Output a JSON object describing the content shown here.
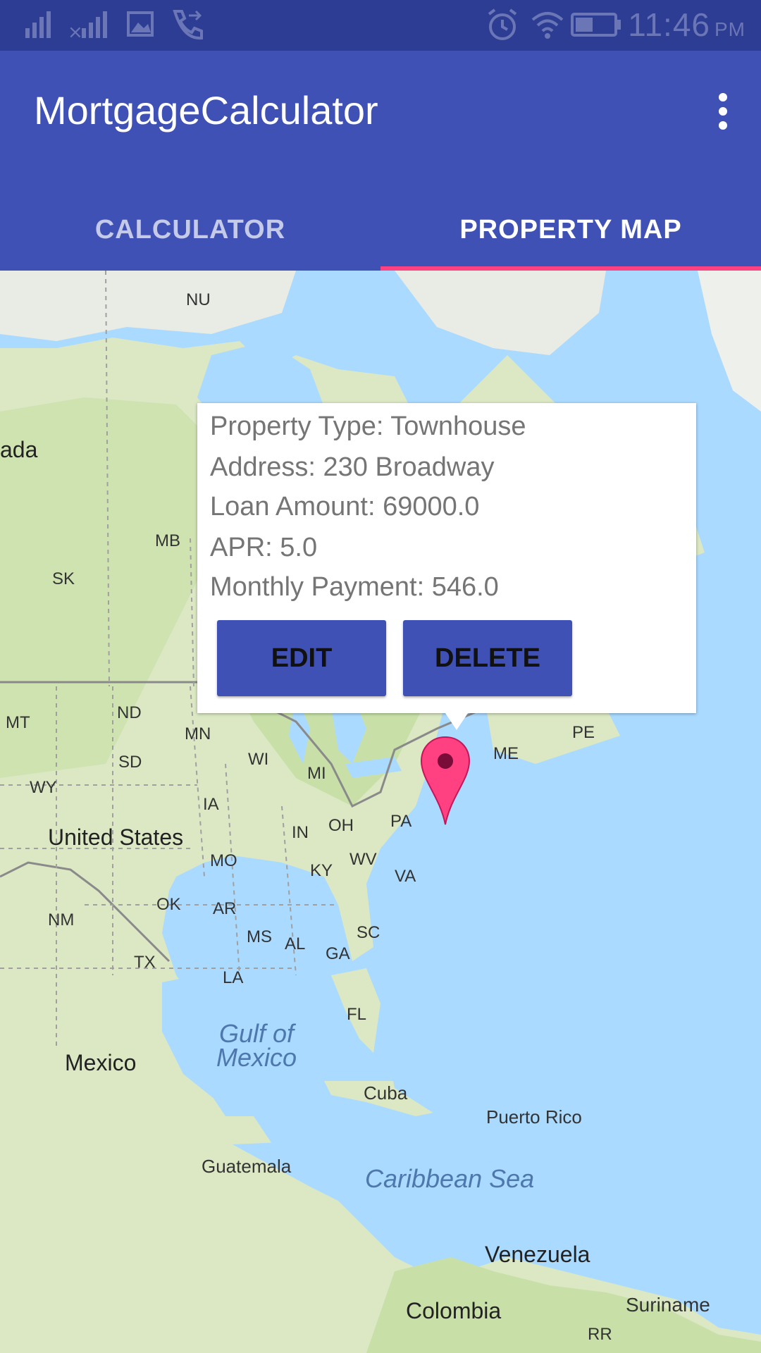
{
  "status_bar": {
    "time": "11:46",
    "ampm": "PM",
    "icons": [
      "signal-1-icon",
      "signal-2-icon",
      "gallery-icon",
      "call-forward-icon",
      "alarm-icon",
      "wifi-icon",
      "battery-icon"
    ]
  },
  "app_bar": {
    "title": "MortgageCalculator",
    "overflow_icon": "more-vert-icon",
    "tabs": [
      {
        "label": "CALCULATOR",
        "selected": false
      },
      {
        "label": "PROPERTY MAP",
        "selected": true
      }
    ]
  },
  "map": {
    "labels": {
      "nu": "NU",
      "ada": "ada",
      "mb": "MB",
      "sk": "SK",
      "mt": "MT",
      "nd": "ND",
      "mn": "MN",
      "sd": "SD",
      "wy": "WY",
      "wi": "WI",
      "mi": "MI",
      "ia": "IA",
      "me": "ME",
      "pe": "PE",
      "pa": "PA",
      "oh": "OH",
      "in": "IN",
      "united_states": "United States",
      "mo": "MO",
      "ky": "KY",
      "wv": "WV",
      "va": "VA",
      "ok": "OK",
      "ar": "AR",
      "nm": "NM",
      "ms": "MS",
      "al": "AL",
      "ga": "GA",
      "sc": "SC",
      "tx": "TX",
      "la": "LA",
      "fl": "FL",
      "gulf": "Gulf of Mexico",
      "mexico": "Mexico",
      "cuba": "Cuba",
      "puerto_rico": "Puerto Rico",
      "guatemala": "Guatemala",
      "caribbean": "Caribbean Sea",
      "venezuela": "Venezuela",
      "colombia": "Colombia",
      "suriname": "Suriname",
      "rr": "RR"
    },
    "marker_icon": "map-pin-icon",
    "colors": {
      "water": "#aadaff",
      "land": "#dce9c4",
      "accent": "#ff4081",
      "primary": "#3f51b5"
    }
  },
  "info_window": {
    "property_type": "Property Type: Townhouse",
    "address": "Address: 230 Broadway",
    "loan_amount": "Loan Amount: 69000.0",
    "apr": "APR: 5.0",
    "monthly_payment": "Monthly Payment: 546.0",
    "edit_label": "EDIT",
    "delete_label": "DELETE"
  }
}
